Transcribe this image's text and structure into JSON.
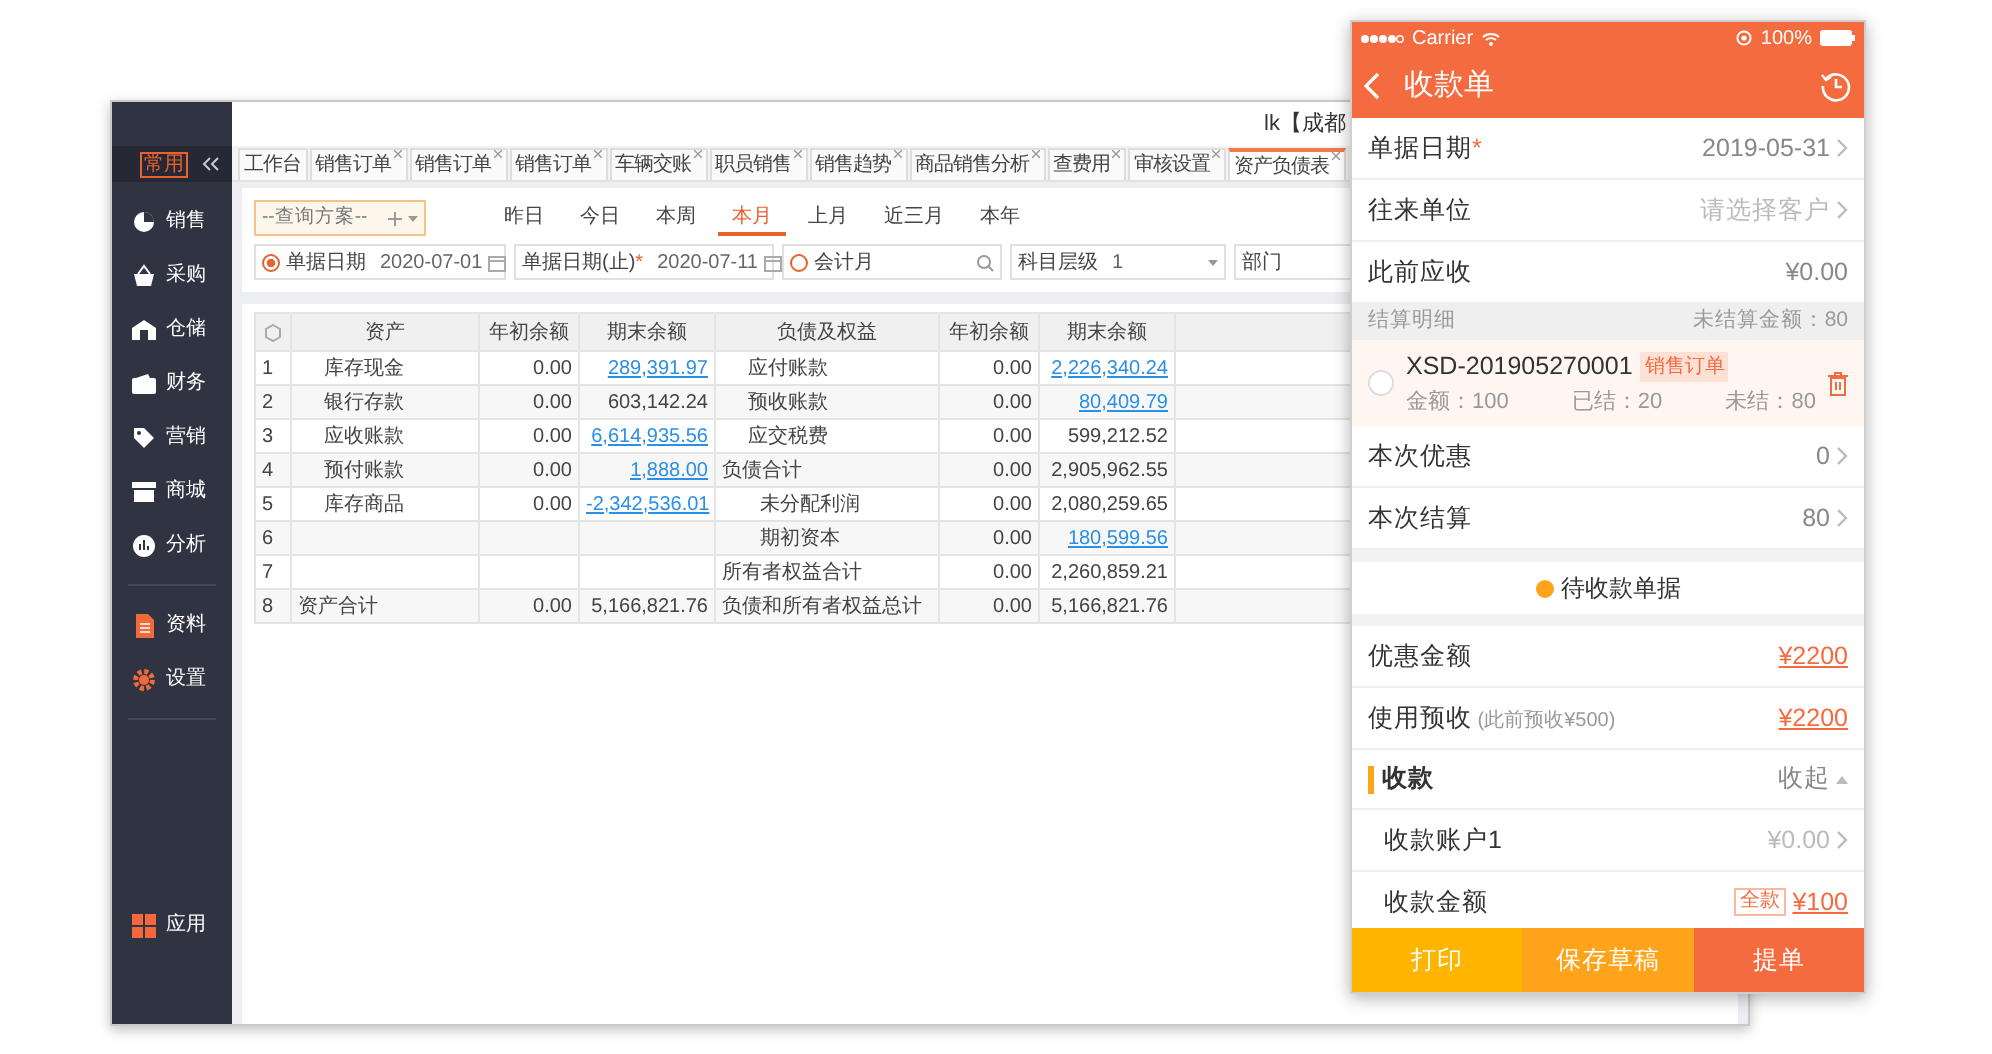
{
  "desktop": {
    "title": "lk【成都",
    "sidebar": {
      "pin_label": "常用",
      "groups": [
        [
          {
            "label": "销售"
          },
          {
            "label": "采购"
          },
          {
            "label": "仓储"
          },
          {
            "label": "财务"
          },
          {
            "label": "营销"
          },
          {
            "label": "商城"
          },
          {
            "label": "分析"
          }
        ],
        [
          {
            "label": "资料"
          },
          {
            "label": "设置"
          }
        ],
        [
          {
            "label": "应用"
          }
        ]
      ]
    },
    "tabs": [
      {
        "label": "工作台",
        "closable": false,
        "selected": false
      },
      {
        "label": "销售订单",
        "closable": true,
        "selected": false
      },
      {
        "label": "销售订单",
        "closable": true,
        "selected": false
      },
      {
        "label": "销售订单",
        "closable": true,
        "selected": false
      },
      {
        "label": "车辆交账",
        "closable": true,
        "selected": false
      },
      {
        "label": "职员销售",
        "closable": true,
        "selected": false
      },
      {
        "label": "销售趋势",
        "closable": true,
        "selected": false
      },
      {
        "label": "商品销售分析",
        "closable": true,
        "selected": false
      },
      {
        "label": "查费用",
        "closable": true,
        "selected": false
      },
      {
        "label": "审核设置",
        "closable": true,
        "selected": false
      },
      {
        "label": "资产负债表",
        "closable": true,
        "selected": true
      }
    ],
    "filters": {
      "scheme": {
        "placeholder": "--查询方案--"
      },
      "quick_dates": [
        {
          "label": "昨日",
          "selected": false
        },
        {
          "label": "今日",
          "selected": false
        },
        {
          "label": "本周",
          "selected": false
        },
        {
          "label": "本月",
          "selected": true
        },
        {
          "label": "上月",
          "selected": false
        },
        {
          "label": "近三月",
          "selected": false
        },
        {
          "label": "本年",
          "selected": false
        }
      ],
      "fields": [
        {
          "kind": "date",
          "label": "单据日期",
          "value": "2020-07-01",
          "radio": true,
          "checked": true
        },
        {
          "kind": "date",
          "label": "单据日期(止)",
          "required_mark": "*",
          "value": "2020-07-11",
          "radio": false
        },
        {
          "kind": "search",
          "label": "会计月",
          "radio": true,
          "checked": false
        },
        {
          "kind": "select",
          "label": "科目层级",
          "value": "1",
          "radio": false
        },
        {
          "kind": "text",
          "label": "部门",
          "radio": false
        }
      ]
    },
    "table": {
      "columns": [
        "资产",
        "年初余额",
        "期末余额",
        "负债及权益",
        "年初余额",
        "期末余额"
      ],
      "rows": [
        {
          "no": "1",
          "asset": {
            "name": "库存现金",
            "kind": "item",
            "begin": "0.00",
            "end": "289,391.97",
            "linked": true
          },
          "liability": {
            "name": "应付账款",
            "kind": "item",
            "begin": "0.00",
            "end": "2,226,340.24",
            "linked": true
          }
        },
        {
          "no": "2",
          "asset": {
            "name": "银行存款",
            "kind": "item",
            "begin": "0.00",
            "end": "603,142.24",
            "linked": false
          },
          "liability": {
            "name": "预收账款",
            "kind": "item",
            "begin": "0.00",
            "end": "80,409.79",
            "linked": true
          }
        },
        {
          "no": "3",
          "asset": {
            "name": "应收账款",
            "kind": "item",
            "begin": "0.00",
            "end": "6,614,935.56",
            "linked": true
          },
          "liability": {
            "name": "应交税费",
            "kind": "item",
            "begin": "0.00",
            "end": "599,212.52",
            "linked": false
          }
        },
        {
          "no": "4",
          "asset": {
            "name": "预付账款",
            "kind": "item",
            "begin": "0.00",
            "end": "1,888.00",
            "linked": true
          },
          "liability": {
            "name": "负债合计",
            "kind": "total",
            "begin": "0.00",
            "end": "2,905,962.55",
            "linked": false
          }
        },
        {
          "no": "5",
          "asset": {
            "name": "库存商品",
            "kind": "item",
            "begin": "0.00",
            "end": "-2,342,536.01",
            "linked": true
          },
          "liability": {
            "name": "未分配利润",
            "kind": "subitem",
            "begin": "0.00",
            "end": "2,080,259.65",
            "linked": false
          }
        },
        {
          "no": "6",
          "liability": {
            "name": "期初资本",
            "kind": "subitem",
            "begin": "0.00",
            "end": "180,599.56",
            "linked": true
          }
        },
        {
          "no": "7",
          "liability": {
            "name": "所有者权益合计",
            "kind": "total",
            "begin": "0.00",
            "end": "2,260,859.21",
            "linked": false
          }
        },
        {
          "no": "8",
          "asset": {
            "name": "资产合计",
            "kind": "total",
            "begin": "0.00",
            "end": "5,166,821.76",
            "linked": false
          },
          "liability": {
            "name": "负债和所有者权益总计",
            "kind": "total",
            "begin": "0.00",
            "end": "5,166,821.76",
            "linked": false
          }
        }
      ]
    }
  },
  "phone": {
    "status": {
      "carrier": "Carrier",
      "battery": "100%"
    },
    "title": "收款单",
    "fields": [
      {
        "label": "单据日期",
        "required_mark": "*",
        "value": "2019-05-31",
        "chevron": true
      },
      {
        "label": "往来单位",
        "placeholder": "请选择客户",
        "chevron": true
      },
      {
        "label": "此前应收",
        "value": "¥0.00",
        "chevron": false
      }
    ],
    "settlement": {
      "title": "结算明细",
      "summary": "未结算金额：80",
      "items": [
        {
          "code": "XSD-201905270001",
          "tag": "销售订单",
          "checked": false,
          "amount": "金额：100",
          "settled": "已结：20",
          "unsettled": "未结：80"
        }
      ]
    },
    "adjustments": [
      {
        "label": "本次优惠",
        "value": "0",
        "chevron": true
      },
      {
        "label": "本次结算",
        "value": "80",
        "chevron": true
      }
    ],
    "pending_button": "待收款单据",
    "amounts": [
      {
        "label": "优惠金额",
        "value": "¥2200"
      },
      {
        "label": "使用预收",
        "note": "(此前预收¥500)",
        "value": "¥2200"
      }
    ],
    "payment": {
      "title": "收款",
      "toggle": "收起",
      "expanded": true,
      "rows": [
        {
          "kind": "select",
          "label": "收款账户1",
          "value": "¥0.00"
        },
        {
          "kind": "amount",
          "label": "收款金额",
          "tag": "全款",
          "value": "¥100"
        }
      ]
    },
    "actions": [
      {
        "label": "打印",
        "color": "#ffb400"
      },
      {
        "label": "保存草稿",
        "color": "#ffa31a"
      },
      {
        "label": "提单",
        "color": "#f46b3f"
      }
    ]
  }
}
